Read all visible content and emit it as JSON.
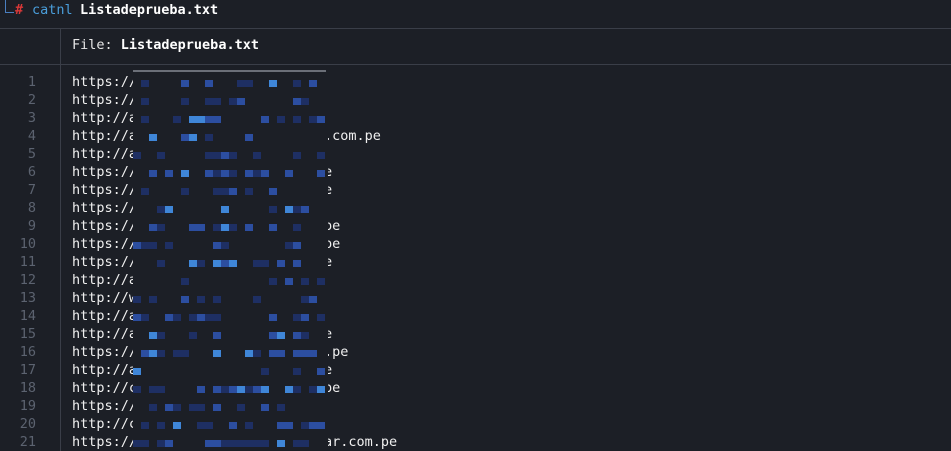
{
  "prompt": {
    "hash": "#",
    "command": "catnl",
    "argument": "Listadeprueba.txt"
  },
  "header": {
    "label": "File:",
    "filename": "Listadeprueba.txt"
  },
  "lines": [
    {
      "num": "1",
      "text": "https://",
      "tail": ""
    },
    {
      "num": "2",
      "text": "https://",
      "tail": ""
    },
    {
      "num": "3",
      "text": "http://a",
      "tail": ""
    },
    {
      "num": "4",
      "text": "http://a",
      "tail": ".com.pe"
    },
    {
      "num": "5",
      "text": "http://a",
      "tail": ""
    },
    {
      "num": "6",
      "text": "https://",
      "tail": "e"
    },
    {
      "num": "7",
      "text": "https://",
      "tail": "e"
    },
    {
      "num": "8",
      "text": "https://",
      "tail": ""
    },
    {
      "num": "9",
      "text": "https://",
      "tail": "pe"
    },
    {
      "num": "10",
      "text": "https://",
      "tail": "pe"
    },
    {
      "num": "11",
      "text": "https://",
      "tail": "e"
    },
    {
      "num": "12",
      "text": "http://a",
      "tail": ""
    },
    {
      "num": "13",
      "text": "http://w",
      "tail": ""
    },
    {
      "num": "14",
      "text": "http://a",
      "tail": ""
    },
    {
      "num": "15",
      "text": "http://a",
      "tail": "e"
    },
    {
      "num": "16",
      "text": "https://",
      "tail": ".pe"
    },
    {
      "num": "17",
      "text": "http://a",
      "tail": "e"
    },
    {
      "num": "18",
      "text": "http://c",
      "tail": "pe"
    },
    {
      "num": "19",
      "text": "https://",
      "tail": ""
    },
    {
      "num": "20",
      "text": "http://c",
      "tail": ""
    },
    {
      "num": "21",
      "text": "https://",
      "tail": "ar.com.pe"
    }
  ],
  "colors": {
    "background": "#1c1f26",
    "pixel_dark": "#1e2f63",
    "pixel_mid": "#2c4ea0",
    "pixel_light": "#3f86d8"
  }
}
